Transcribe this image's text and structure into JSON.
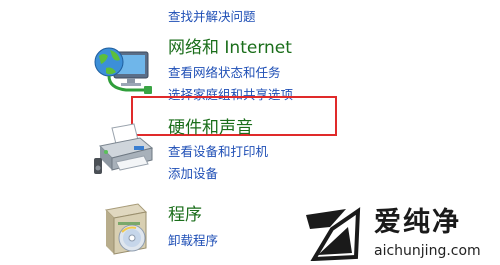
{
  "control_panel": {
    "top_link": "查找并解决问题",
    "network": {
      "title": "网络和 Internet",
      "links": [
        "查看网络状态和任务",
        "选择家庭组和共享选项"
      ],
      "icon": "network-globe-icon"
    },
    "hardware": {
      "title": "硬件和声音",
      "links": [
        "查看设备和打印机",
        "添加设备"
      ],
      "icon": "printer-icon"
    },
    "programs": {
      "title": "程序",
      "links": [
        "卸载程序"
      ],
      "icon": "programs-box-icon"
    }
  },
  "highlight": {
    "color": "#e02a2a",
    "target": "硬件和声音"
  },
  "watermark": {
    "title": "爱纯净",
    "subtitle": "aichunjing.com"
  },
  "colors": {
    "heading": "#1b6e1b",
    "link": "#1f4fb6",
    "background": "#ffffff"
  }
}
